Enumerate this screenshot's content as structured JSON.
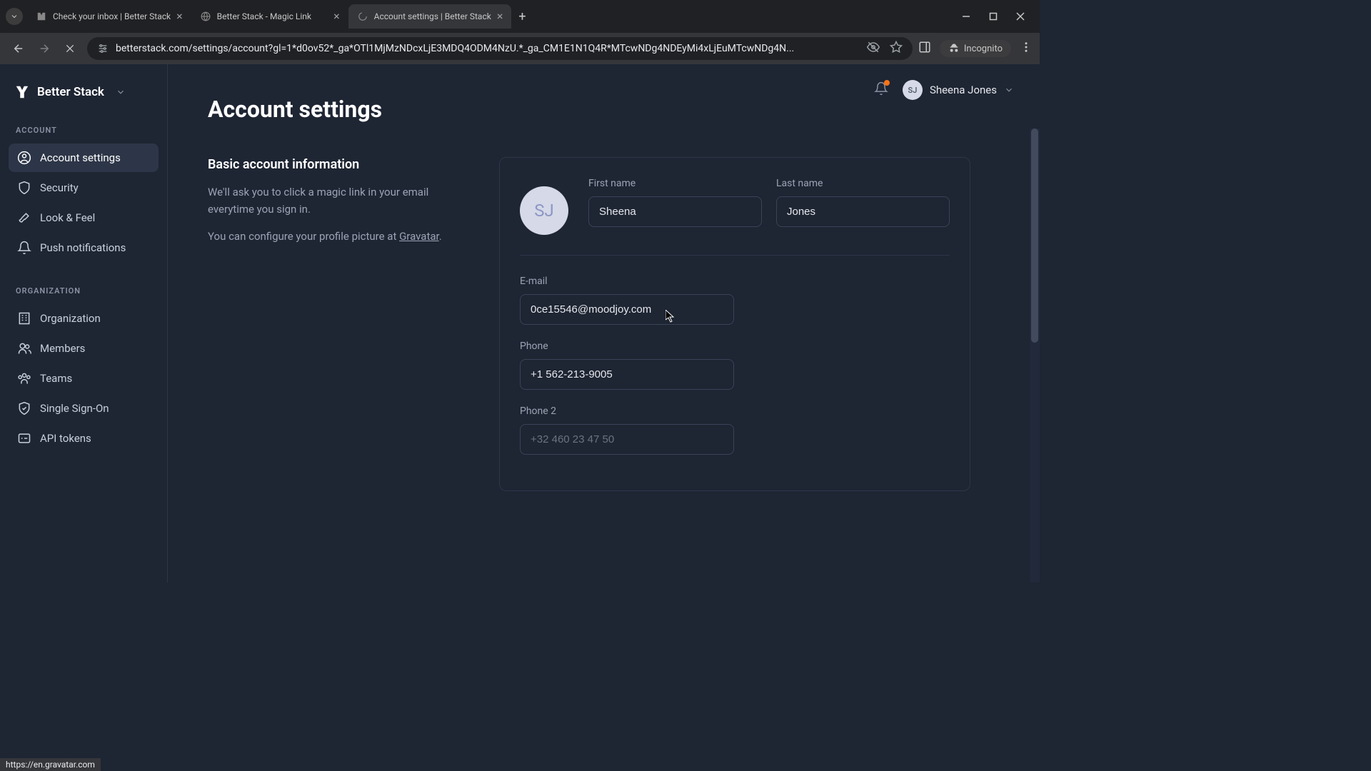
{
  "browser": {
    "tabs": [
      {
        "title": "Check your inbox | Better Stack"
      },
      {
        "title": "Better Stack - Magic Link"
      },
      {
        "title": "Account settings | Better Stack"
      }
    ],
    "url": "betterstack.com/settings/account?gl=1*d0ov52*_ga*OTl1MjMzNDcxLjE3MDQ4ODM4NzU.*_ga_CM1E1N1Q4R*MTcwNDg4NDEyMi4xLjEuMTcwNDg4N...",
    "incognito_label": "Incognito"
  },
  "brand": {
    "name": "Better Stack"
  },
  "sidebar": {
    "sections": {
      "account_label": "ACCOUNT",
      "organization_label": "ORGANIZATION"
    },
    "items": {
      "account_settings": "Account settings",
      "security": "Security",
      "look_feel": "Look & Feel",
      "push_notifications": "Push notifications",
      "organization": "Organization",
      "members": "Members",
      "teams": "Teams",
      "single_sign_on": "Single Sign-On",
      "api_tokens": "API tokens"
    }
  },
  "topbar": {
    "user_name": "Sheena Jones",
    "user_initials": "SJ"
  },
  "page": {
    "title": "Account settings",
    "section_heading": "Basic account information",
    "section_desc_1": "We'll ask you to click a magic link in your email everytime you sign in.",
    "section_desc_2a": "You can configure your profile picture at ",
    "section_desc_2b": "Gravatar",
    "section_desc_2c": "."
  },
  "form": {
    "avatar_initials": "SJ",
    "first_name_label": "First name",
    "first_name_value": "Sheena",
    "last_name_label": "Last name",
    "last_name_value": "Jones",
    "email_label": "E-mail",
    "email_value": "0ce15546@moodjoy.com",
    "phone_label": "Phone",
    "phone_value": "+1 562-213-9005",
    "phone2_label": "Phone 2",
    "phone2_placeholder": "+32 460 23 47 50"
  },
  "status_bar": {
    "url": "https://en.gravatar.com"
  }
}
